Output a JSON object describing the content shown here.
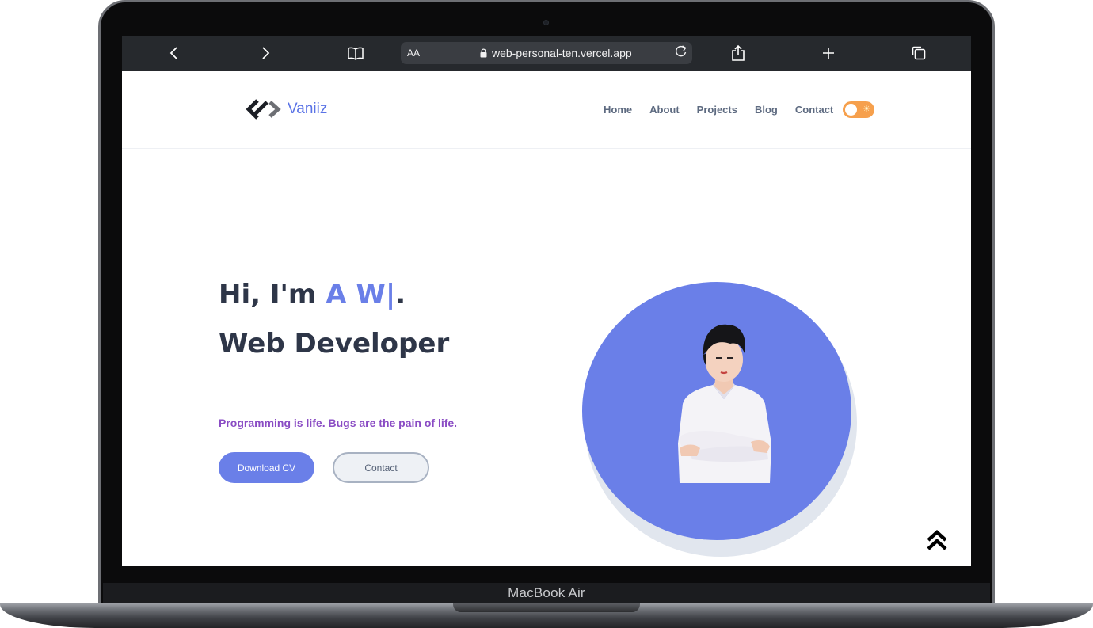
{
  "device": {
    "label": "MacBook Air"
  },
  "browser": {
    "text_size_label": "AA",
    "url": "web-personal-ten.vercel.app"
  },
  "site": {
    "brand": "Vaniiz",
    "nav": [
      {
        "label": "Home"
      },
      {
        "label": "About"
      },
      {
        "label": "Projects"
      },
      {
        "label": "Blog"
      },
      {
        "label": "Contact"
      }
    ],
    "theme_toggle": {
      "state": "light",
      "icon": "sun-icon"
    }
  },
  "hero": {
    "greeting": "Hi, I'm ",
    "typed_name": "A W",
    "cursor": "|",
    "period": ".",
    "role": "Web Developer",
    "tagline": "Programming is life. Bugs are the pain of life.",
    "download_label": "Download CV",
    "contact_label": "Contact"
  },
  "colors": {
    "accent": "#6a7fe8",
    "heading": "#2e3648",
    "tagline": "#8a4cc4",
    "toggle": "#f6a04d",
    "browser_bar": "#26292d"
  }
}
